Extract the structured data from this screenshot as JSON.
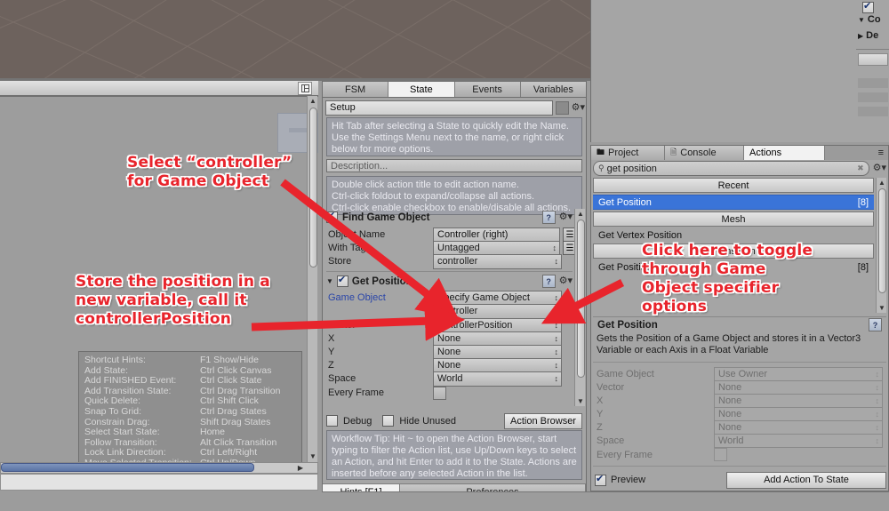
{
  "scene": {
    "name": "scene-view"
  },
  "fsm_panel": {
    "tabs": [
      {
        "label": "FSM",
        "active": false
      },
      {
        "label": "State",
        "active": true
      },
      {
        "label": "Events",
        "active": false
      },
      {
        "label": "Variables",
        "active": false
      }
    ],
    "state_name": "Setup",
    "state_hint": "Hit Tab after selecting a State to quickly edit the Name.\nUse the Settings Menu next to the name, or right click\nbelow for more options.",
    "description_placeholder": "Description...",
    "action_hint": "Double click action title to edit action name.\nCtrl-click foldout to expand/collapse all actions.\nCtrl-click enable checkbox to enable/disable all actions.",
    "actions": [
      {
        "title": "Find Game Object",
        "enabled": true,
        "rows": [
          {
            "label": "Object Name",
            "value": "Controller (right)",
            "kind": "text",
            "hasEq": true
          },
          {
            "label": "With Tag",
            "value": "Untagged",
            "kind": "popup",
            "hasEq": true
          },
          {
            "label": "Store",
            "value": "controller",
            "kind": "popup",
            "hasEq": false
          }
        ]
      },
      {
        "title": "Get Position",
        "enabled": true,
        "rows": [
          {
            "label": "Game Object",
            "value": "Specify Game Object",
            "kind": "popup",
            "blue": true
          },
          {
            "label": "",
            "value": "controller",
            "kind": "popup",
            "hasToggleBtn": true
          },
          {
            "label": "Vector",
            "value": "controllerPosition",
            "kind": "popup"
          },
          {
            "label": "X",
            "value": "None",
            "kind": "popup"
          },
          {
            "label": "Y",
            "value": "None",
            "kind": "popup"
          },
          {
            "label": "Z",
            "value": "None",
            "kind": "popup"
          },
          {
            "label": "Space",
            "value": "World",
            "kind": "popup"
          },
          {
            "label": "Every Frame",
            "value": "",
            "kind": "checkbox"
          }
        ]
      }
    ],
    "debug_label": "Debug",
    "hide_unused_label": "Hide Unused",
    "action_browser_label": "Action Browser",
    "workflow_tip": "Workflow Tip: Hit ~ to open the Action Browser, start\ntyping to filter the Action list, use Up/Down keys to select\nan Action, and hit Enter to add it to the State. Actions are\ninserted before any selected Action in the list.",
    "bottom_tabs": [
      {
        "label": "Hints [F1]",
        "active": true
      },
      {
        "label": "Preferences",
        "active": false
      }
    ]
  },
  "actions_panel": {
    "tabs": [
      {
        "label": "Project",
        "icon": "folder-icon",
        "active": false
      },
      {
        "label": "Console",
        "icon": "console-icon",
        "active": false
      },
      {
        "label": "Actions",
        "icon": "",
        "active": true
      }
    ],
    "search_value": "get position",
    "search_icon": "search-icon",
    "clear_icon": "clear-icon",
    "gear_icon": "gear-icon",
    "list": [
      {
        "label": "Recent",
        "type": "category"
      },
      {
        "label": "Get Position",
        "type": "item",
        "count": "[8]",
        "selected": true
      },
      {
        "label": "Mesh",
        "type": "category"
      },
      {
        "label": "Get Vertex Position",
        "type": "item",
        "count": "",
        "selected": false
      },
      {
        "label": "Transform",
        "type": "category"
      },
      {
        "label": "Get Position",
        "type": "item",
        "count": "[8]",
        "selected": false
      }
    ],
    "preview": {
      "title": "Get Position",
      "help_icon": "help-icon",
      "description": "Gets the Position of a Game Object and stores it in a Vector3\nVariable or each Axis in a Float Variable",
      "rows": [
        {
          "label": "Game Object",
          "value": "Use Owner",
          "kind": "popup"
        },
        {
          "label": "Vector",
          "value": "None",
          "kind": "popup"
        },
        {
          "label": "X",
          "value": "None",
          "kind": "popup"
        },
        {
          "label": "Y",
          "value": "None",
          "kind": "popup"
        },
        {
          "label": "Z",
          "value": "None",
          "kind": "popup"
        },
        {
          "label": "Space",
          "value": "World",
          "kind": "popup"
        },
        {
          "label": "Every Frame",
          "value": "",
          "kind": "checkbox"
        }
      ],
      "preview_label": "Preview",
      "add_button_label": "Add Action To State"
    }
  },
  "hierarchy": {
    "items": [
      {
        "label": "Co",
        "arrow": "▼"
      },
      {
        "label": "De",
        "arrow": "▶"
      }
    ]
  },
  "hints": {
    "rows": [
      {
        "key": "Shortcut Hints:",
        "value": "F1 Show/Hide"
      },
      {
        "key": "Add State:",
        "value": "Ctrl Click Canvas"
      },
      {
        "key": "Add FINISHED Event:",
        "value": "Ctrl Click State"
      },
      {
        "key": "Add Transition State:",
        "value": "Ctrl Drag Transition"
      },
      {
        "key": "Quick Delete:",
        "value": "Ctrl Shift Click"
      },
      {
        "key": "Snap To Grid:",
        "value": "Ctrl Drag States"
      },
      {
        "key": "Constrain Drag:",
        "value": "Shift Drag States"
      },
      {
        "key": "Select Start State:",
        "value": "Home"
      },
      {
        "key": "Follow Transition:",
        "value": "Alt Click Transition"
      },
      {
        "key": "Lock Link Direction:",
        "value": "Ctrl Left/Right"
      },
      {
        "key": "Move Selected Transition:",
        "value": "Ctrl Up/Down"
      }
    ]
  },
  "annotations": [
    {
      "id": "anno-select-controller",
      "text": "Select “controller”\nfor Game Object"
    },
    {
      "id": "anno-store-position",
      "text": "Store the position in a\nnew variable, call it\ncontrollerPosition"
    },
    {
      "id": "anno-click-toggle",
      "text": "Click here to toggle\nthrough Game\nObject specifier\noptions"
    }
  ],
  "colors": {
    "accent_red": "#e8242c",
    "selection_blue": "#3a74d8",
    "panel_gray": "#a5a5a5"
  }
}
